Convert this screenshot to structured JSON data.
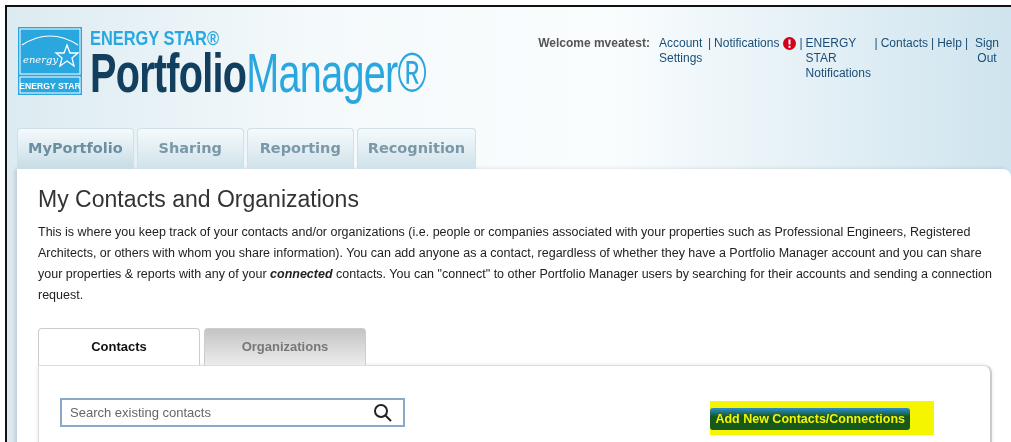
{
  "brand": {
    "badge_script": "energy",
    "badge_text": "ENERGY STAR",
    "title_top": "ENERGY STAR®",
    "title_bold": "Portfolio",
    "title_light": "Manager®"
  },
  "user_bar": {
    "welcome": "Welcome mveatest:",
    "items": [
      {
        "kind": "link",
        "label": "Account Settings"
      },
      {
        "kind": "separator",
        "text": "|"
      },
      {
        "kind": "link",
        "label": "Notifications"
      },
      {
        "kind": "alert_icon"
      },
      {
        "kind": "separator",
        "text": "|"
      },
      {
        "kind": "link",
        "label": "ENERGY STAR Notifications"
      },
      {
        "kind": "separator",
        "text": "|"
      },
      {
        "kind": "link",
        "label": "Contacts"
      },
      {
        "kind": "separator",
        "text": "|"
      },
      {
        "kind": "link",
        "label": "Help"
      },
      {
        "kind": "separator",
        "text": "|"
      },
      {
        "kind": "link",
        "label": "Sign Out"
      }
    ]
  },
  "main_tabs": [
    {
      "label": "MyPortfolio",
      "selected": true
    },
    {
      "label": "Sharing",
      "selected": false
    },
    {
      "label": "Reporting",
      "selected": false
    },
    {
      "label": "Recognition",
      "selected": false
    }
  ],
  "page": {
    "title": "My Contacts and Organizations",
    "intro": "This is where you keep track of your contacts and/or organizations (i.e. people or companies associated with your properties such as Professional Engineers, Registered Architects, or others with whom you share information). You can add anyone as a contact, regardless of whether they have a Portfolio Manager account and you can share your properties & reports with any of your **connected** contacts. You can \"connect\" to other Portfolio Manager users by searching for their accounts and sending a connection request."
  },
  "sub_tabs": [
    {
      "label": "Contacts",
      "selected": true
    },
    {
      "label": "Organizations",
      "selected": false
    }
  ],
  "search": {
    "placeholder": "Search existing contacts"
  },
  "add_button": {
    "label": "Add New Contacts/Connections",
    "highlighted": true
  }
}
